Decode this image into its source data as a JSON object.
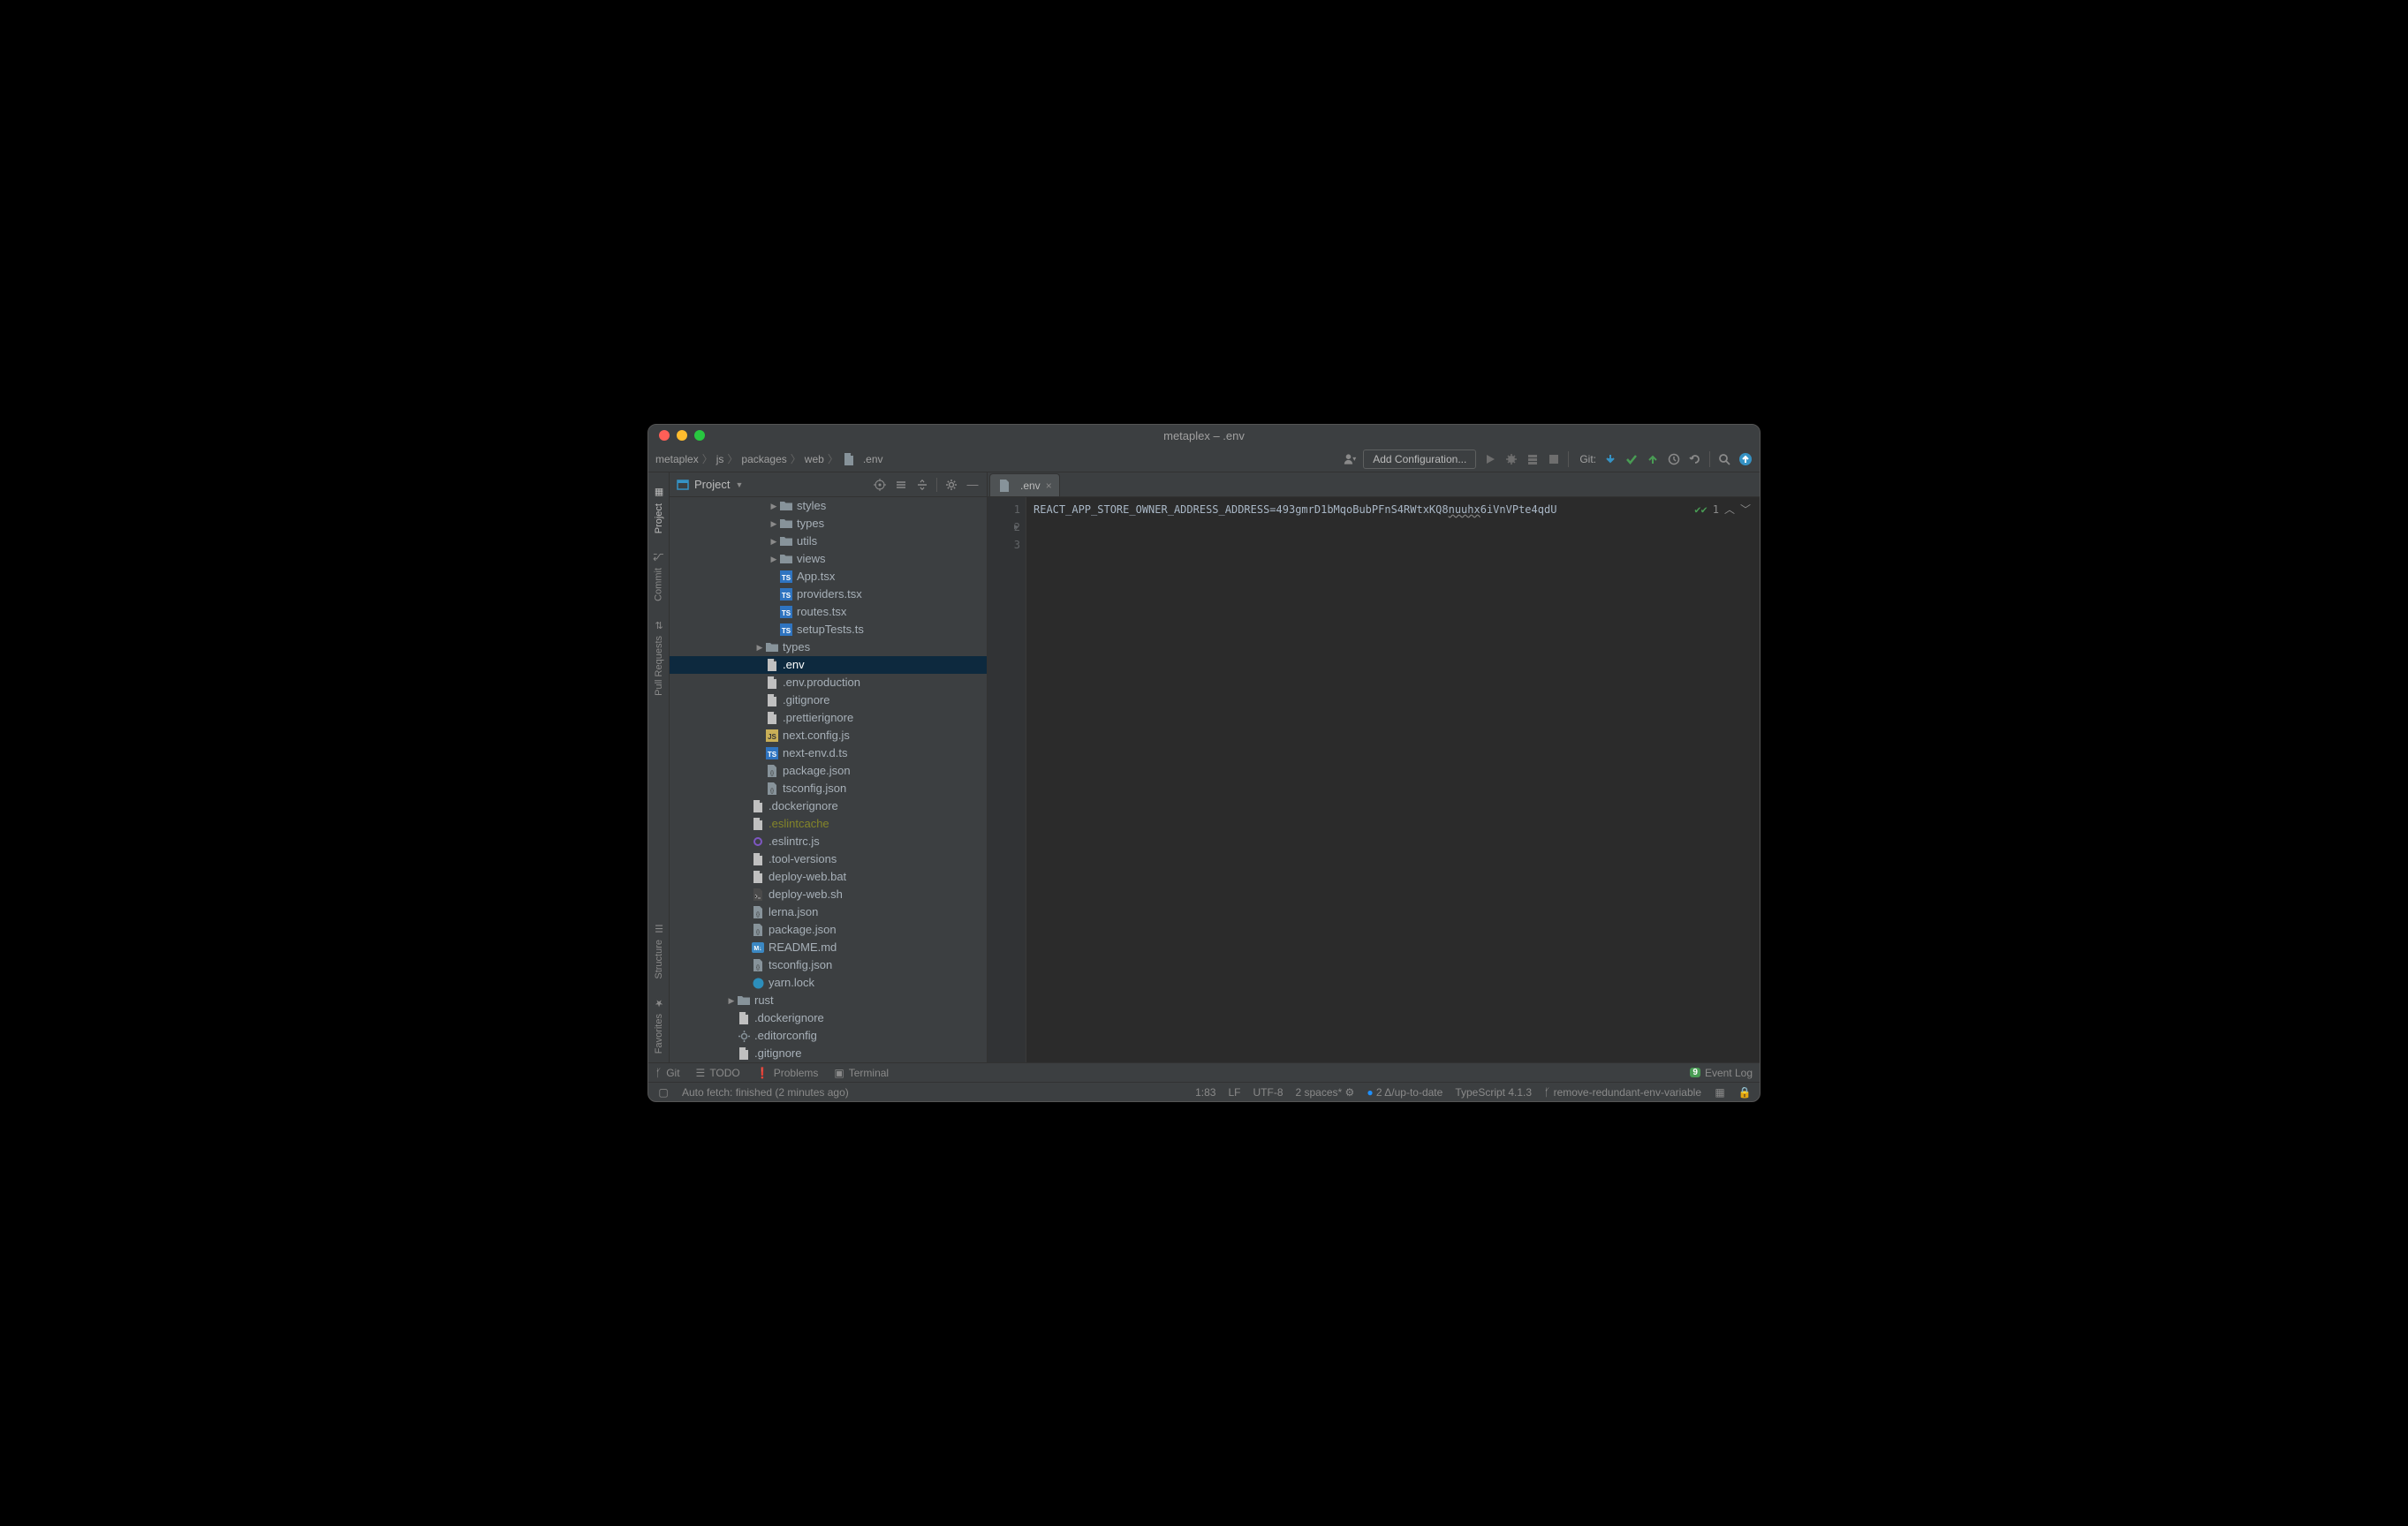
{
  "window_title": "metaplex – .env",
  "breadcrumb": [
    "metaplex",
    "js",
    "packages",
    "web",
    ".env"
  ],
  "toolbar": {
    "add_config": "Add Configuration...",
    "git_label": "Git:"
  },
  "left_rail": {
    "project": "Project",
    "commit": "Commit",
    "pull_requests": "Pull Requests",
    "structure": "Structure",
    "favorites": "Favorites"
  },
  "project_pane": {
    "title": "Project"
  },
  "tree": [
    {
      "indent": 7,
      "toggle": ">",
      "icon": "folder",
      "label": "styles"
    },
    {
      "indent": 7,
      "toggle": ">",
      "icon": "folder",
      "label": "types"
    },
    {
      "indent": 7,
      "toggle": ">",
      "icon": "folder",
      "label": "utils"
    },
    {
      "indent": 7,
      "toggle": ">",
      "icon": "folder",
      "label": "views"
    },
    {
      "indent": 7,
      "toggle": "",
      "icon": "tsx",
      "label": "App.tsx"
    },
    {
      "indent": 7,
      "toggle": "",
      "icon": "tsx",
      "label": "providers.tsx"
    },
    {
      "indent": 7,
      "toggle": "",
      "icon": "tsx",
      "label": "routes.tsx"
    },
    {
      "indent": 7,
      "toggle": "",
      "icon": "ts",
      "label": "setupTests.ts"
    },
    {
      "indent": 6,
      "toggle": ">",
      "icon": "folder",
      "label": "types"
    },
    {
      "indent": 6,
      "toggle": "",
      "icon": "txt",
      "label": ".env",
      "selected": true
    },
    {
      "indent": 6,
      "toggle": "",
      "icon": "txt",
      "label": ".env.production"
    },
    {
      "indent": 6,
      "toggle": "",
      "icon": "txt",
      "label": ".gitignore"
    },
    {
      "indent": 6,
      "toggle": "",
      "icon": "txt",
      "label": ".prettierignore"
    },
    {
      "indent": 6,
      "toggle": "",
      "icon": "js",
      "label": "next.config.js"
    },
    {
      "indent": 6,
      "toggle": "",
      "icon": "ts",
      "label": "next-env.d.ts"
    },
    {
      "indent": 6,
      "toggle": "",
      "icon": "json",
      "label": "package.json"
    },
    {
      "indent": 6,
      "toggle": "",
      "icon": "json",
      "label": "tsconfig.json"
    },
    {
      "indent": 5,
      "toggle": "",
      "icon": "txt",
      "label": ".dockerignore"
    },
    {
      "indent": 5,
      "toggle": "",
      "icon": "txt",
      "label": ".eslintcache",
      "ignored": true
    },
    {
      "indent": 5,
      "toggle": "",
      "icon": "ring",
      "label": ".eslintrc.js"
    },
    {
      "indent": 5,
      "toggle": "",
      "icon": "txt",
      "label": ".tool-versions"
    },
    {
      "indent": 5,
      "toggle": "",
      "icon": "txt",
      "label": "deploy-web.bat"
    },
    {
      "indent": 5,
      "toggle": "",
      "icon": "sh",
      "label": "deploy-web.sh"
    },
    {
      "indent": 5,
      "toggle": "",
      "icon": "json",
      "label": "lerna.json"
    },
    {
      "indent": 5,
      "toggle": "",
      "icon": "json",
      "label": "package.json"
    },
    {
      "indent": 5,
      "toggle": "",
      "icon": "md",
      "label": "README.md"
    },
    {
      "indent": 5,
      "toggle": "",
      "icon": "json",
      "label": "tsconfig.json"
    },
    {
      "indent": 5,
      "toggle": "",
      "icon": "yarn",
      "label": "yarn.lock"
    },
    {
      "indent": 4,
      "toggle": ">",
      "icon": "folder",
      "label": "rust"
    },
    {
      "indent": 4,
      "toggle": "",
      "icon": "txt",
      "label": ".dockerignore"
    },
    {
      "indent": 4,
      "toggle": "",
      "icon": "gear",
      "label": ".editorconfig"
    },
    {
      "indent": 4,
      "toggle": "",
      "icon": "txt",
      "label": ".gitignore"
    }
  ],
  "editor": {
    "tab_name": ".env",
    "lines": {
      "1": "REACT_APP_STORE_OWNER_ADDRESS_ADDRESS=493gmrD1bMqoBubPFnS4RWtxKQ8",
      "1b": "nuuhx",
      "1c": "6iVnVPte4qdU",
      "line_numbers": [
        "1",
        "2",
        "3"
      ]
    },
    "inspection_count": "1"
  },
  "tools": {
    "git": "Git",
    "todo": "TODO",
    "problems": "Problems",
    "terminal": "Terminal",
    "event_log": "Event Log",
    "event_badge": "9"
  },
  "status": {
    "message": "Auto fetch: finished (2 minutes ago)",
    "pos": "1:83",
    "eol": "LF",
    "enc": "UTF-8",
    "indent": "2 spaces*",
    "git_status": "2 Δ/up-to-date",
    "ts": "TypeScript 4.1.3",
    "branch": "remove-redundant-env-variable"
  }
}
